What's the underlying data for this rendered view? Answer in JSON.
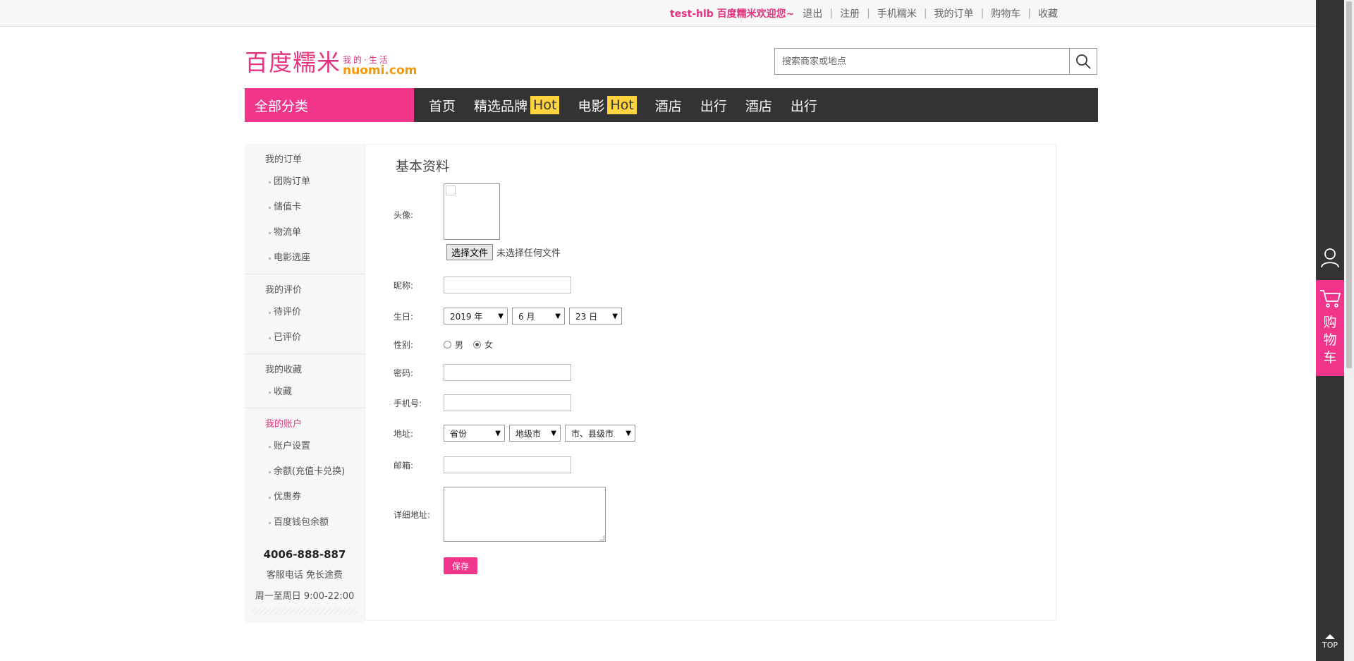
{
  "topbar": {
    "welcome": "test-hlb 百度糯米欢迎您~",
    "links": [
      "退出",
      "注册",
      "手机糯米",
      "我的订单",
      "购物车",
      "收藏"
    ],
    "separator": "|"
  },
  "logo": {
    "main": "百度糯米",
    "tagline": "我的·生活",
    "domain": "nuomi.com"
  },
  "search": {
    "placeholder": "搜索商家或地点",
    "icon": "search-icon"
  },
  "nav": {
    "all_categories": "全部分类",
    "items": [
      {
        "label": "首页",
        "badge": ""
      },
      {
        "label": "精选品牌",
        "badge": "Hot"
      },
      {
        "label": "电影",
        "badge": "Hot"
      },
      {
        "label": "酒店",
        "badge": ""
      },
      {
        "label": "出行",
        "badge": ""
      },
      {
        "label": "酒店",
        "badge": ""
      },
      {
        "label": "出行",
        "badge": ""
      }
    ]
  },
  "sidebar": {
    "groups": [
      {
        "title": "我的订单",
        "items": [
          "团购订单",
          "储值卡",
          "物流单",
          "电影选座"
        ]
      },
      {
        "title": "我的评价",
        "items": [
          "待评价",
          "已评价"
        ]
      },
      {
        "title": "我的收藏",
        "items": [
          "收藏"
        ]
      },
      {
        "title": "我的账户",
        "items": [
          "账户设置",
          "余额(充值卡兑换)",
          "优惠券",
          "百度钱包余额"
        ]
      }
    ],
    "hotline": {
      "phone": "4006-888-887",
      "desc": "客服电话 免长途费",
      "hours": "周一至周日 9:00-22:00"
    }
  },
  "form": {
    "title": "基本资料",
    "avatar_label": "头像:",
    "file_button": "选择文件",
    "file_status": "未选择任何文件",
    "nickname_label": "昵称:",
    "birthday_label": "生日:",
    "birthday": {
      "year": "2019 年",
      "month": "6 月",
      "day": "23 日"
    },
    "gender_label": "性别:",
    "gender_male": "男",
    "gender_female": "女",
    "gender_selected": "女",
    "password_label": "密码:",
    "phone_label": "手机号:",
    "address_label": "地址:",
    "address": {
      "province": "省份",
      "city": "地级市",
      "county": "市、县级市"
    },
    "zip_label": "邮箱:",
    "detail_label": "详细地址:",
    "save_button": "保存"
  },
  "dock": {
    "user_icon": "user-icon",
    "cart_icon": "cart-icon",
    "cart_label": "购物车",
    "top_label": "TOP"
  },
  "colors": {
    "brand_pink": "#f0358a",
    "hot_yellow": "#ffd33d",
    "nav_dark": "#333333",
    "logo_orange": "#f39800"
  }
}
